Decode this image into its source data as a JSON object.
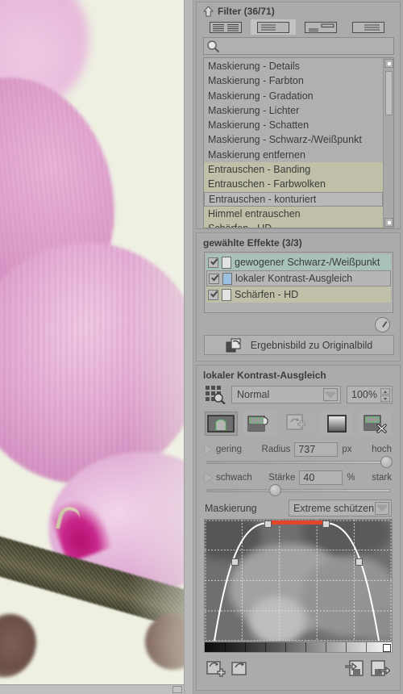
{
  "photo": {
    "alt_description": "close-up of pink orchid blossom with dark stem on cream background",
    "background_color": "#eef0e2",
    "petal_color": "#dca0cc",
    "stem_color": "#5d5a40",
    "lip_color": "#b4126f"
  },
  "filter_panel": {
    "title": "Filter (36/71)",
    "collapse_icon": "arrow-up-icon",
    "view_modes": [
      {
        "icon": "view-two-column-icon",
        "selected": false
      },
      {
        "icon": "view-list-icon",
        "selected": true
      },
      {
        "icon": "view-detail-icon",
        "selected": false
      },
      {
        "icon": "view-compact-icon",
        "selected": false
      }
    ],
    "search": {
      "icon": "search-icon",
      "value": "",
      "placeholder": ""
    },
    "items": [
      {
        "label": "Maskierung - Details",
        "state": "normal"
      },
      {
        "label": "Maskierung - Farbton",
        "state": "normal"
      },
      {
        "label": "Maskierung - Gradation",
        "state": "normal"
      },
      {
        "label": "Maskierung - Lichter",
        "state": "normal"
      },
      {
        "label": "Maskierung - Schatten",
        "state": "normal"
      },
      {
        "label": "Maskierung - Schwarz-/Weißpunkt",
        "state": "normal"
      },
      {
        "label": "Maskierung entfernen",
        "state": "normal"
      },
      {
        "label": "Entrauschen - Banding",
        "state": "olive"
      },
      {
        "label": "Entrauschen - Farbwolken",
        "state": "olive"
      },
      {
        "label": "Entrauschen - konturiert",
        "state": "current"
      },
      {
        "label": "Himmel entrauschen",
        "state": "olive"
      },
      {
        "label": "Schärfen - HD",
        "state": "olive"
      }
    ],
    "scrollbar": {
      "up_icon": "scroll-up-icon",
      "down_icon": "scroll-down-icon"
    }
  },
  "effects_panel": {
    "title": "gewählte Effekte (3/3)",
    "items": [
      {
        "label": "gewogener Schwarz-/Weißpunkt",
        "checked": true,
        "row_style": "teal",
        "doc_icon": "document-icon"
      },
      {
        "label": "lokaler Kontrast-Ausgleich",
        "checked": true,
        "row_style": "selected",
        "doc_icon": "document-blue-icon"
      },
      {
        "label": "Schärfen - HD",
        "checked": true,
        "row_style": "olive",
        "doc_icon": "document-icon"
      }
    ],
    "dial_icon": "timer-dial-icon",
    "compare_button": {
      "label": "Ergebnisbild zu Originalbild",
      "icon": "compare-images-icon"
    }
  },
  "params_panel": {
    "title": "lokaler Kontrast-Ausgleich",
    "mode_icon": "grid-lens-icon",
    "blend_mode": {
      "value": "Normal",
      "caret_icon": "chevron-down-icon"
    },
    "opacity": {
      "value": "100%",
      "up_icon": "spin-up-icon",
      "down_icon": "spin-down-icon"
    },
    "mask_tools": [
      {
        "icon": "mask-edit-icon",
        "active": true
      },
      {
        "icon": "mask-brush-icon",
        "active": false
      },
      {
        "icon": "mask-add-icon",
        "active": false,
        "disabled": true
      },
      {
        "icon": "mask-gradient-icon",
        "active": false
      },
      {
        "icon": "mask-delete-icon",
        "active": false
      }
    ],
    "sliders": [
      {
        "expander_icon": "triangle-right-icon",
        "min_label": "gering",
        "name": "Radius",
        "value": "737",
        "unit": "px",
        "max_label": "hoch",
        "thumb_percent": 97
      },
      {
        "expander_icon": "triangle-right-icon",
        "min_label": "schwach",
        "name": "Stärke",
        "value": "40",
        "unit": "%",
        "max_label": "stark",
        "thumb_percent": 36
      }
    ],
    "masking": {
      "label": "Maskierung",
      "value": "Extreme schützen",
      "caret_icon": "chevron-down-icon"
    },
    "curve": {
      "type": "bell-curve",
      "control_points": [
        {
          "x": 10,
          "y": 96
        },
        {
          "x": 34,
          "y": 36
        },
        {
          "x": 66,
          "y": 36
        },
        {
          "x": 90,
          "y": 96
        }
      ],
      "highlight_bar_color": "#e2452a",
      "curve_color": "#ffffff",
      "grid": true
    },
    "gradient_ramp": {
      "from": "#000000",
      "to": "#ffffff",
      "handle_position": "right"
    },
    "bottom_tools": [
      {
        "icon": "mask-new-icon"
      },
      {
        "icon": "mask-open-icon"
      },
      {
        "icon": "mask-import-icon"
      },
      {
        "icon": "mask-export-icon"
      }
    ]
  }
}
